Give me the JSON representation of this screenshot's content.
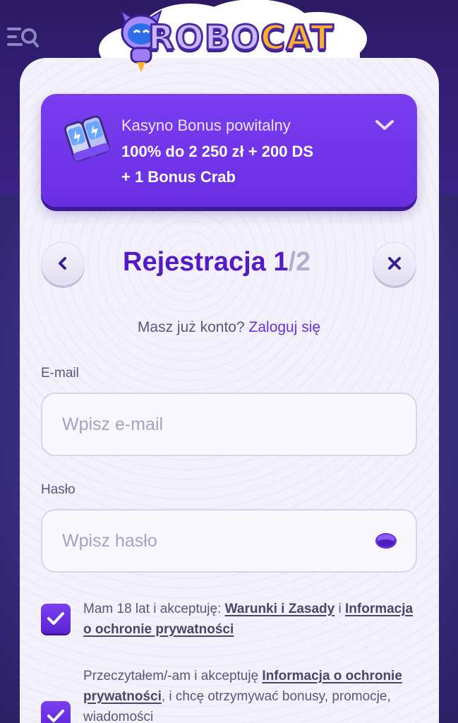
{
  "header": {
    "logo_text_robo": "ROBO",
    "logo_text_cat": "CAT"
  },
  "bonus": {
    "title": "Kasyno Bonus powitalny",
    "line1": "100% do 2 250 zł + 200 DS",
    "line2": "+ 1 Bonus Crab"
  },
  "registration": {
    "title_prefix": "Rejestracja ",
    "step_current": "1",
    "step_separator": "/",
    "step_total": "2"
  },
  "login_prompt": {
    "text": "Masz już konto?",
    "link": "Zaloguj się"
  },
  "email": {
    "label": "E-mail",
    "placeholder": "Wpisz e-mail",
    "value": ""
  },
  "password": {
    "label": "Hasło",
    "placeholder": "Wpisz hasło",
    "value": ""
  },
  "consents": [
    {
      "checked": true,
      "text_a": "Mam 18 lat i akceptuję: ",
      "link_a": "Warunki i Zasady",
      "text_b": " i ",
      "link_b": "Informacja o ochronie prywatności"
    },
    {
      "checked": true,
      "text_a": "Przeczytałem/-am i akceptuję ",
      "link_a": "Informacja o ochronie prywatności",
      "text_b": ", i chcę otrzymywać bonusy, promocje, wiadomości"
    }
  ],
  "colors": {
    "accent": "#5419c9",
    "bonus_bg": "#6a2ee3",
    "card_bg": "#f3f1fb",
    "header_bg": "#2c1a64"
  },
  "icons": {
    "menu": "menu-search-icon",
    "bonus": "battery-bonus-icon",
    "expand": "chevron-down-icon",
    "back": "chevron-left-icon",
    "close": "close-icon",
    "password_toggle": "eye-icon",
    "check": "checkmark-icon"
  }
}
